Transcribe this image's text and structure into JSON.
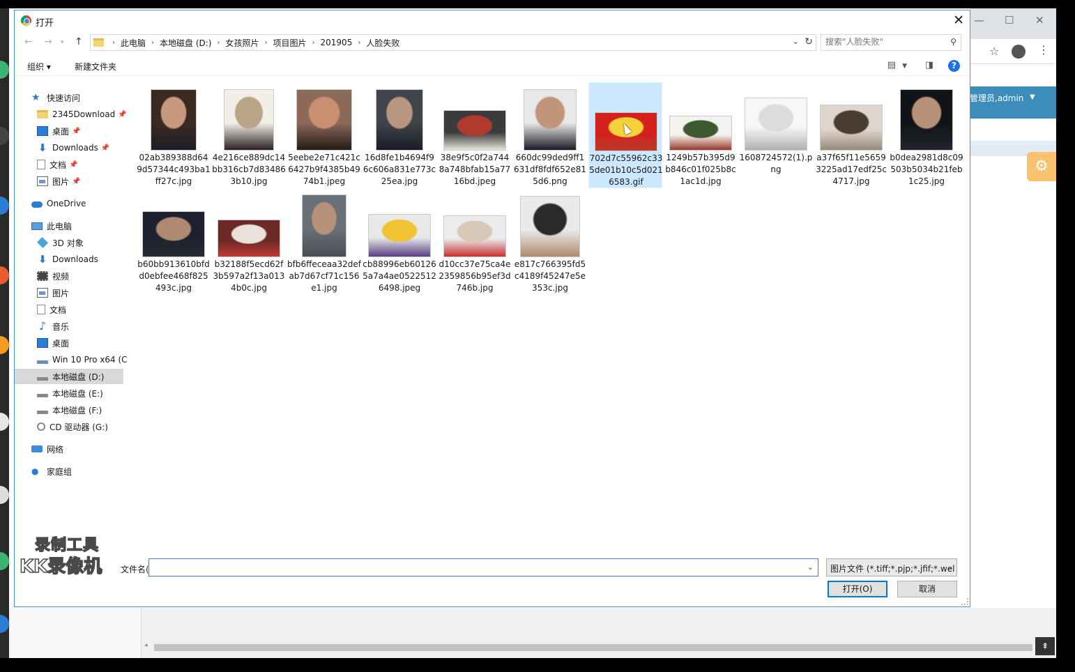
{
  "dialog": {
    "title": "打开"
  },
  "address": {
    "crumbs": [
      "此电脑",
      "本地磁盘 (D:)",
      "女孩照片",
      "项目图片",
      "201905",
      "人脸失败"
    ],
    "search_placeholder": "搜索\"人脸失败\""
  },
  "toolbar": {
    "organize": "组织 ▾",
    "new_folder": "新建文件夹"
  },
  "navpane": {
    "items": [
      {
        "label": "快速访问",
        "icon": "star-icon"
      },
      {
        "label": "2345Download",
        "icon": "folder-icon",
        "pinned": true
      },
      {
        "label": "桌面",
        "icon": "desktop-icon",
        "pinned": true
      },
      {
        "label": "Downloads",
        "icon": "download-icon",
        "pinned": true
      },
      {
        "label": "文档",
        "icon": "document-icon",
        "pinned": true
      },
      {
        "label": "图片",
        "icon": "picture-icon",
        "pinned": true
      },
      {
        "label": "OneDrive",
        "icon": "cloud-icon"
      },
      {
        "label": "此电脑",
        "icon": "pc-icon"
      },
      {
        "label": "3D 对象",
        "icon": "cube-icon"
      },
      {
        "label": "Downloads",
        "icon": "download-icon"
      },
      {
        "label": "视频",
        "icon": "video-icon"
      },
      {
        "label": "图片",
        "icon": "picture-icon"
      },
      {
        "label": "文档",
        "icon": "document-icon"
      },
      {
        "label": "音乐",
        "icon": "music-icon"
      },
      {
        "label": "桌面",
        "icon": "desktop-icon"
      },
      {
        "label": "Win 10 Pro x64 (C",
        "icon": "system-drive-icon"
      },
      {
        "label": "本地磁盘 (D:)",
        "icon": "drive-icon",
        "selected": true
      },
      {
        "label": "本地磁盘 (E:)",
        "icon": "drive-icon"
      },
      {
        "label": "本地磁盘 (F:)",
        "icon": "drive-icon"
      },
      {
        "label": "CD 驱动器 (G:)",
        "icon": "cd-drive-icon"
      },
      {
        "label": "网络",
        "icon": "network-icon"
      },
      {
        "label": "家庭组",
        "icon": "homegroup-icon"
      }
    ]
  },
  "files": [
    {
      "name": "02ab389388d649d57344c493ba1ff27c.jpg",
      "colors": [
        "#3a2a22",
        "#c79a7e",
        "#1e1e28"
      ]
    },
    {
      "name": "4e216ce889dc14bb316cb7d834863b10.jpg",
      "colors": [
        "#f2efe9",
        "#b8a486",
        "#2a2220"
      ]
    },
    {
      "name": "5eebe2e71c421c6427b9f4385b4974b1.jpeg",
      "colors": [
        "#8c6a5a",
        "#c89070",
        "#231a18"
      ]
    },
    {
      "name": "16d8fe1b4694f96c606a831e773c25ea.jpg",
      "colors": [
        "#40454c",
        "#b89680",
        "#1a1c22"
      ]
    },
    {
      "name": "38e9f5c0f2a7448a748bfab15a7716bd.jpeg",
      "colors": [
        "#3b3a3c",
        "#b23a2c",
        "#e8e4dc"
      ]
    },
    {
      "name": "660dc99ded9ff1631df8fdf652e815d6.png",
      "colors": [
        "#e8e8e8",
        "#c0957a",
        "#1a1a22"
      ]
    },
    {
      "name": "702d7c55962c335de01b10c5d0216583.gif",
      "colors": [
        "#d3201d",
        "#f6d33a",
        "#b93a2a"
      ],
      "selected": true
    },
    {
      "name": "1249b57b395d9b846c01f025b8c1ac1d.jpg",
      "colors": [
        "#f4f2ee",
        "#3c5a2e",
        "#9a3a2a"
      ]
    },
    {
      "name": "1608724572(1).png",
      "colors": [
        "#f7f7f7",
        "#dcdcdc",
        "#b0b0b0"
      ]
    },
    {
      "name": "a37f65f11e56593225ad17edf25c4717.jpg",
      "colors": [
        "#dcd6cc",
        "#4a3c30",
        "#9a8a7a"
      ]
    },
    {
      "name": "b0dea2981d8c09503b5034b21feb1c25.jpg",
      "colors": [
        "#101418",
        "#b89078",
        "#20262c"
      ]
    },
    {
      "name": "b60bb913610bfdd0ebfee468f825493c.jpg",
      "colors": [
        "#1e2030",
        "#b08a70",
        "#2a2a36"
      ]
    },
    {
      "name": "b32188f5ecd62f3b597a2f13a0134b0c.jpg",
      "colors": [
        "#6b2a26",
        "#e8e2da",
        "#c03a32"
      ]
    },
    {
      "name": "bfb6ffeceaa32defab7d67cf71c156e1.jpg",
      "colors": [
        "#6a7078",
        "#b89278",
        "#4a4e54"
      ]
    },
    {
      "name": "cb88996eb601265a7a4ae05225126498.jpeg",
      "colors": [
        "#e8e8e8",
        "#f1c232",
        "#5a3e86"
      ]
    },
    {
      "name": "d10cc37e75ca4e2359856b95ef3d746b.jpg",
      "colors": [
        "#ececec",
        "#d8c8b8",
        "#c83030"
      ]
    },
    {
      "name": "e817c766395fd5c4189f45247e5e353c.jpg",
      "colors": [
        "#eaeaea",
        "#2a2a2a",
        "#b08a70"
      ]
    }
  ],
  "bottom": {
    "filename_label": "文件名(N):",
    "filename_value": "",
    "filter": "图片文件 (*.tiff;*.pjp;*.jfif;*.wel",
    "open": "打开(O)",
    "cancel": "取消"
  },
  "background": {
    "user_label": "管理员,admin"
  },
  "watermark": {
    "line1": "录制工具",
    "line2": "KK录像机"
  },
  "colors": {
    "accent": "#0078d7",
    "selection": "#cce8ff",
    "admin_bar": "#3c8dbc"
  }
}
